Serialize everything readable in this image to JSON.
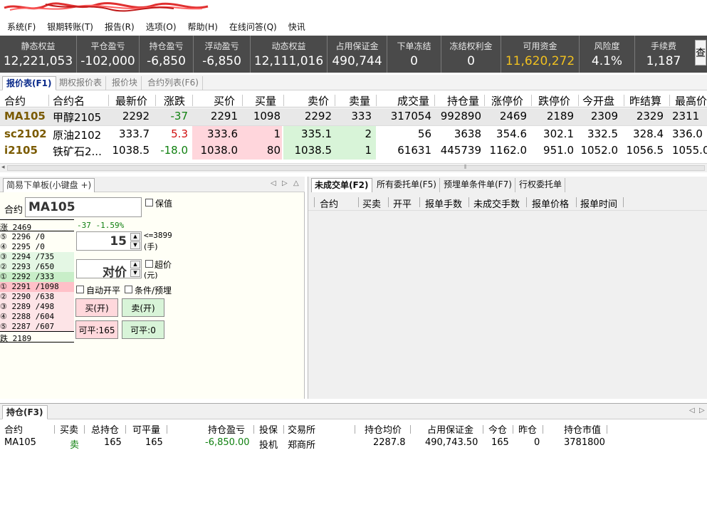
{
  "menu": [
    "系统(F)",
    "银期转账(T)",
    "报告(R)",
    "选项(O)",
    "帮助(H)",
    "在线问答(Q)",
    "快讯"
  ],
  "account": [
    {
      "label": "静态权益",
      "value": "12,221,053"
    },
    {
      "label": "平仓盈亏",
      "value": "-102,000"
    },
    {
      "label": "持仓盈亏",
      "value": "-6,850"
    },
    {
      "label": "浮动盈亏",
      "value": "-6,850"
    },
    {
      "label": "动态权益",
      "value": "12,111,016"
    },
    {
      "label": "占用保证金",
      "value": "490,744"
    },
    {
      "label": "下单冻结",
      "value": "0"
    },
    {
      "label": "冻结权利金",
      "value": "0"
    },
    {
      "label": "可用资金",
      "value": "11,620,272"
    },
    {
      "label": "风险度",
      "value": "4.1%"
    },
    {
      "label": "手续费",
      "value": "1,187"
    }
  ],
  "account_query_label": "查",
  "accent_color": "#f0c020",
  "quote_tabs": [
    "报价表(F1)",
    "期权报价表",
    "报价块",
    "合约列表(F6)"
  ],
  "quote_headers": [
    "合约",
    "合约名",
    "最新价",
    "涨跌",
    "买价",
    "买量",
    "卖价",
    "卖量",
    "成交量",
    "持仓量",
    "涨停价",
    "跌停价",
    "今开盘",
    "昨结算",
    "最高价"
  ],
  "quotes": [
    [
      "MA105",
      "甲醇2105",
      "2292",
      "-37",
      "2291",
      "1098",
      "2292",
      "333",
      "317054",
      "992890",
      "2469",
      "2189",
      "2309",
      "2329",
      "2311"
    ],
    [
      "sc2102",
      "原油2102",
      "333.7",
      "5.3",
      "333.6",
      "1",
      "335.1",
      "2",
      "56",
      "3638",
      "354.6",
      "302.1",
      "332.5",
      "328.4",
      "336.0"
    ],
    [
      "i2105",
      "铁矿石2...",
      "1038.5",
      "-18.0",
      "1038.0",
      "80",
      "1038.5",
      "1",
      "61631",
      "445739",
      "1162.0",
      "951.0",
      "1052.0",
      "1056.5",
      "1055.0"
    ]
  ],
  "order_panel": {
    "title": "简易下单板(小键盘 +)",
    "contract_label": "合约",
    "contract_value": "MA105",
    "hedge_label": "保值",
    "change_text": "-37 -1.59%",
    "limit_up_label": "涨",
    "limit_up": "2469",
    "limit_down_label": "跌",
    "limit_down": "2189",
    "asks": [
      {
        "idx": "⑤",
        "price": "2296",
        "vol": "/0"
      },
      {
        "idx": "④",
        "price": "2295",
        "vol": "/0"
      },
      {
        "idx": "③",
        "price": "2294",
        "vol": "/735"
      },
      {
        "idx": "②",
        "price": "2293",
        "vol": "/650"
      },
      {
        "idx": "①",
        "price": "2292",
        "vol": "/333"
      }
    ],
    "bids": [
      {
        "idx": "①",
        "price": "2291",
        "vol": "/1098"
      },
      {
        "idx": "②",
        "price": "2290",
        "vol": "/638"
      },
      {
        "idx": "③",
        "price": "2289",
        "vol": "/498"
      },
      {
        "idx": "④",
        "price": "2288",
        "vol": "/604"
      },
      {
        "idx": "⑤",
        "price": "2287",
        "vol": "/607"
      }
    ],
    "qty": "15",
    "qty_limit": "<=3899",
    "qty_unit": "(手)",
    "price_value": "对价",
    "over_price_label": "超价",
    "price_unit": "(元)",
    "auto_open_close": "自动开平",
    "cond_label": "条件/预埋",
    "buy_open": "买(开)",
    "sell_open": "卖(开)",
    "close_buy": "可平:165",
    "close_sell": "可平:0"
  },
  "order_tabs": [
    "未成交单(F2)",
    "所有委托单(F5)",
    "预埋单条件单(F7)",
    "行权委托单"
  ],
  "order_headers": [
    "合约",
    "买卖",
    "开平",
    "报单手数",
    "未成交手数",
    "报单价格",
    "报单时间"
  ],
  "position_tab": "持仓(F3)",
  "position_headers": [
    "合约",
    "买卖",
    "总持仓",
    "可平量",
    "持仓盈亏",
    "投保",
    "交易所",
    "持仓均价",
    "占用保证金",
    "今仓",
    "昨仓",
    "持仓市值"
  ],
  "positions": [
    [
      "MA105",
      "卖",
      "165",
      "165",
      "-6,850.00",
      "投机",
      "郑商所",
      "2287.8",
      "490,743.50",
      "165",
      "0",
      "3781800"
    ]
  ]
}
